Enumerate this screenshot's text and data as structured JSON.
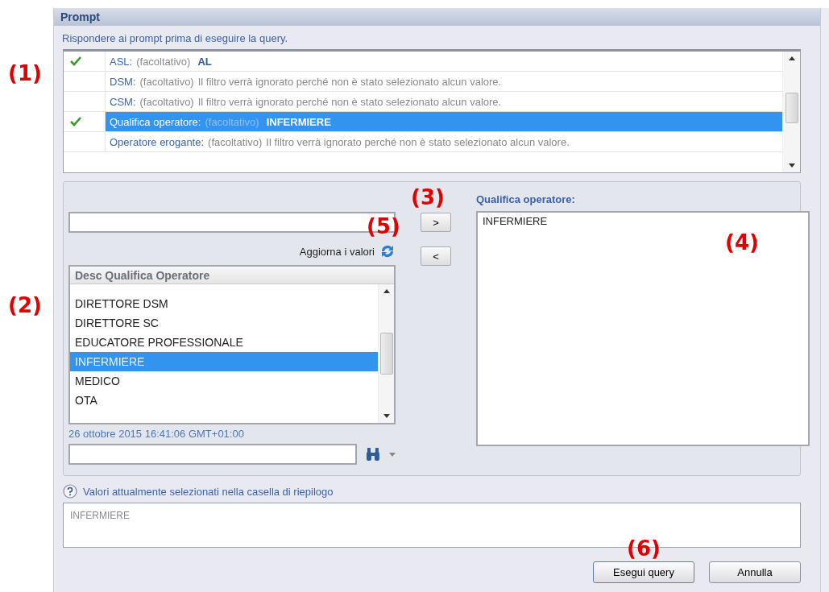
{
  "annotations": [
    "(1)",
    "(2)",
    "(3)",
    "(5)",
    "(4)",
    "(6)"
  ],
  "window": {
    "title": "Prompt"
  },
  "instruction": "Rispondere ai prompt prima di eseguire la query.",
  "prompts": [
    {
      "label": "ASL:",
      "optional": "(facoltativo)",
      "detail": "AL",
      "kind": "value",
      "answered": true,
      "selected": false
    },
    {
      "label": "DSM:",
      "optional": "(facoltativo)",
      "detail": "Il filtro verrà ignorato perché non è stato selezionato alcun valore.",
      "kind": "message",
      "answered": false,
      "selected": false
    },
    {
      "label": "CSM:",
      "optional": "(facoltativo)",
      "detail": "Il filtro verrà ignorato perché non è stato selezionato alcun valore.",
      "kind": "message",
      "answered": false,
      "selected": false
    },
    {
      "label": "Qualifica operatore:",
      "optional": "(facoltativo)",
      "detail": "INFERMIERE",
      "kind": "value",
      "answered": true,
      "selected": true
    },
    {
      "label": "Operatore erogante:",
      "optional": "(facoltativo)",
      "detail": "Il filtro verrà ignorato perché non è stato selezionato alcun valore.",
      "kind": "message",
      "answered": false,
      "selected": false
    }
  ],
  "refresh_label": "Aggiorna i valori",
  "values_list": {
    "column": "Desc Qualifica Operatore",
    "items": [
      {
        "label": "DIRETTORE DSM",
        "selected": false
      },
      {
        "label": "DIRETTORE SC",
        "selected": false
      },
      {
        "label": "EDUCATORE PROFESSIONALE",
        "selected": false
      },
      {
        "label": "INFERMIERE",
        "selected": true
      },
      {
        "label": "MEDICO",
        "selected": false
      },
      {
        "label": "OTA",
        "selected": false
      }
    ]
  },
  "timestamp": "26 ottobre 2015 16:41:06 GMT+01:00",
  "add_button": ">",
  "remove_button": "<",
  "selected_panel": {
    "title": "Qualifica operatore:",
    "items": [
      "INFERMIERE"
    ]
  },
  "help_text": "Valori attualmente selezionati nella casella di riepilogo",
  "summary": "INFERMIERE",
  "buttons": [
    "Esegui query",
    "Annulla"
  ]
}
